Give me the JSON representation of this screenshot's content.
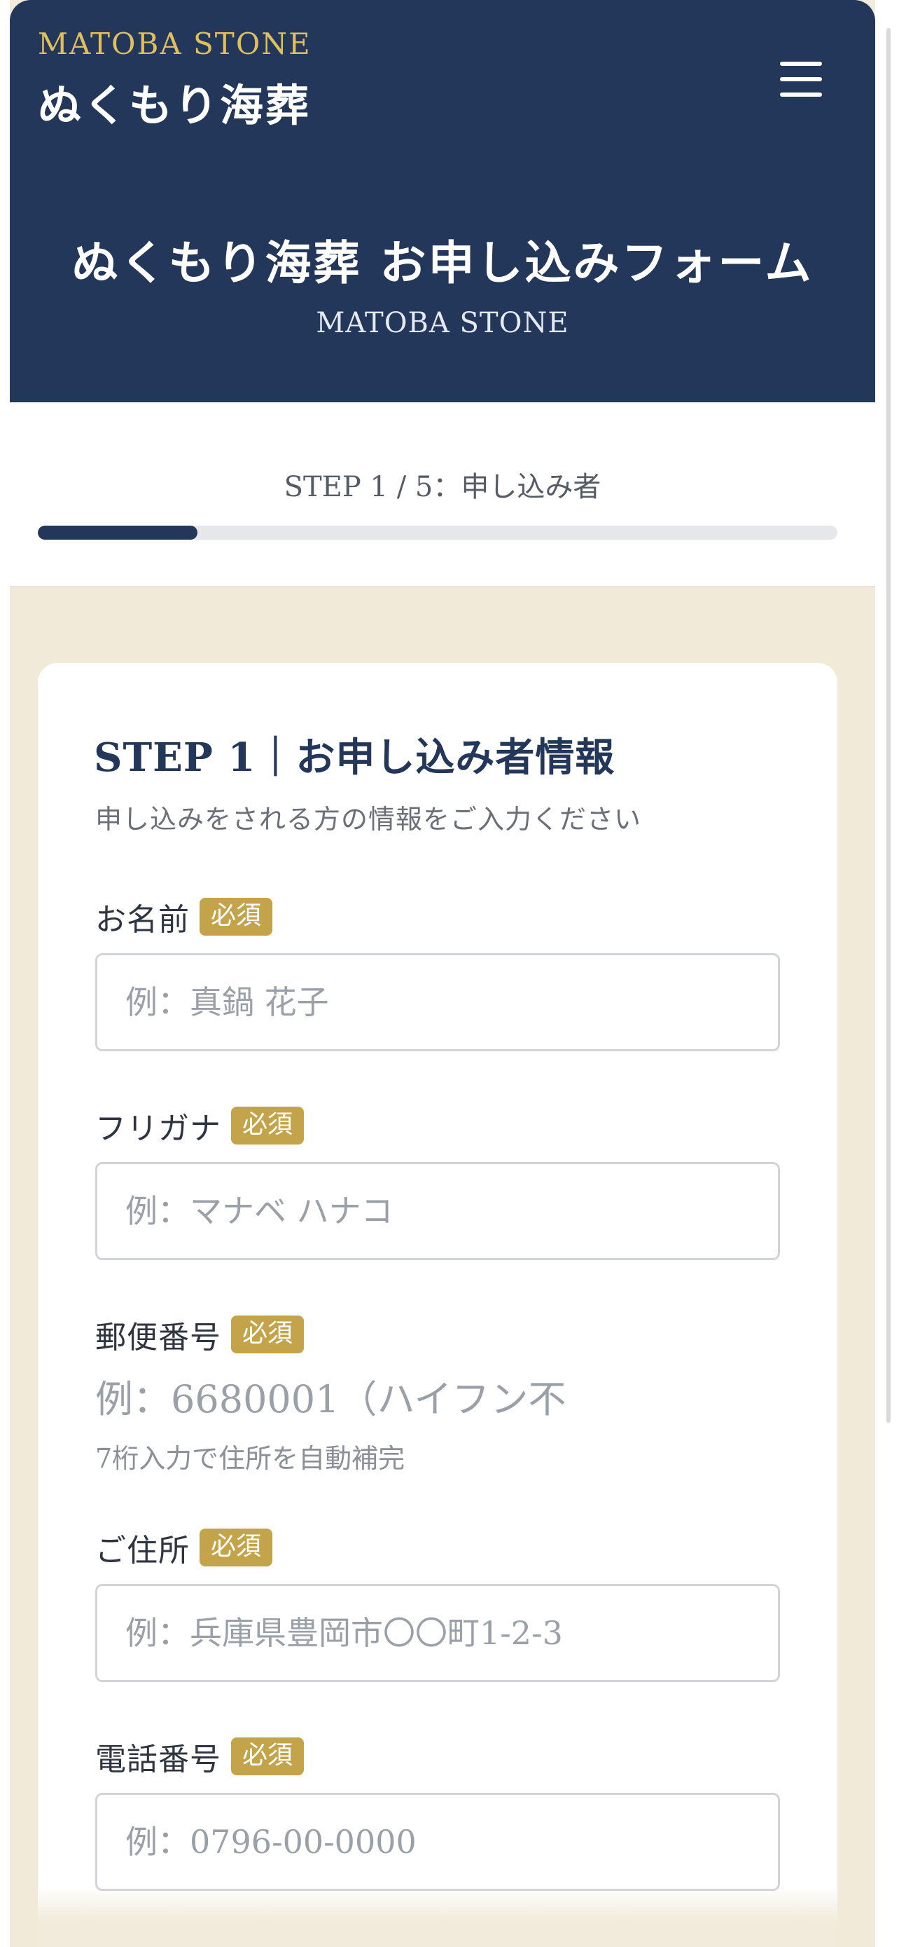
{
  "header": {
    "brand_en": "MATOBA STONE",
    "brand_ja": "ぬくもり海葬",
    "menu_icon": "hamburger-menu-icon",
    "title": "ぬくもり海葬 お申し込みフォーム",
    "subtitle": "MATOBA STONE"
  },
  "progress": {
    "label": "STEP 1 / 5：申し込み者",
    "current_step": 1,
    "total_steps": 5,
    "fraction": 0.2
  },
  "form": {
    "step_title": "STEP 1｜お申し込み者情報",
    "step_description": "申し込みをされる方の情報をご入力ください",
    "required_badge": "必須",
    "fields": {
      "name": {
        "label": "お名前",
        "placeholder": "例：真鍋 花子"
      },
      "furigana": {
        "label": "フリガナ",
        "placeholder": "例：マナベ ハナコ"
      },
      "postal": {
        "label": "郵便番号",
        "placeholder": "例：6680001（ハイフン不",
        "hint": "7桁入力で住所を自動補完"
      },
      "address": {
        "label": "ご住所",
        "placeholder": "例：兵庫県豊岡市〇〇町1-2-3"
      },
      "phone": {
        "label": "電話番号",
        "placeholder": "例：0796-00-0000"
      }
    }
  },
  "colors": {
    "header_bg": "#23375a",
    "accent_gold": "#c4a44a",
    "brand_gold": "#e0bf5e",
    "page_bg": "#f1ead9"
  }
}
